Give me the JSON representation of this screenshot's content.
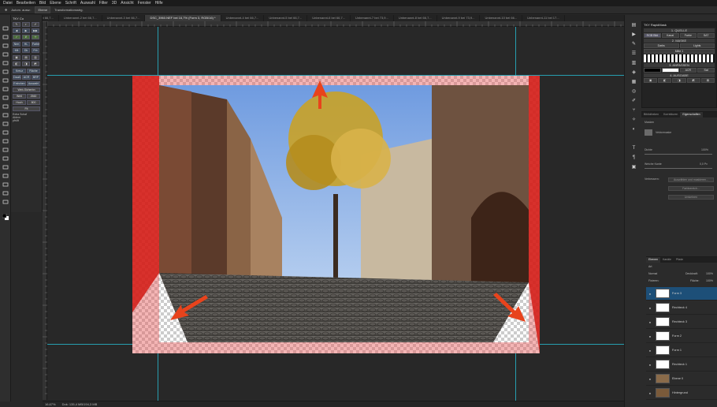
{
  "menu": [
    "Datei",
    "Bearbeiten",
    "Bild",
    "Ebene",
    "Schrift",
    "Auswahl",
    "Filter",
    "3D",
    "Ansicht",
    "Fenster",
    "Hilfe"
  ],
  "options": {
    "auto_select_label": "Autom. ausw.:",
    "layer_target": "Ebene",
    "transform_label": "Transformationsstrg."
  },
  "tabs": [
    {
      "label": "Unbenannt-1 bei 66,7...",
      "active": false
    },
    {
      "label": "Unbenannt-2 bei 66,7...",
      "active": false
    },
    {
      "label": "Unbenannt-3 bei 66,7...",
      "active": false
    },
    {
      "label": "DSC_3960.NEF bei 16,7% (Form 3, RGB/16) *",
      "active": true
    },
    {
      "label": "Unbenannt-4 bei 66,7...",
      "active": false
    },
    {
      "label": "Unbenannt-5 bei 66,7...",
      "active": false
    },
    {
      "label": "Unbenannt-6 bei 66,7...",
      "active": false
    },
    {
      "label": "Unbenannt-7 bei 73,9...",
      "active": false
    },
    {
      "label": "Unbenannt-8 bei 66,7...",
      "active": false
    },
    {
      "label": "Unbenannt-9 bei 73,9...",
      "active": false
    },
    {
      "label": "Unbenannt-10 bei 66...",
      "active": false
    },
    {
      "label": "Unbenannt-11 bei 17...",
      "active": false
    }
  ],
  "plugin": {
    "title": "TKY Co",
    "grid_a": [
      "Nrm",
      "HL",
      "Farbe",
      "Mit",
      "Dk",
      "Frb"
    ],
    "row_b": [
      "Kreuz",
      "Fläche"
    ],
    "row_c": [
      "Dauß",
      "ACR",
      "BRP"
    ],
    "row_d": [
      "Entrohen",
      "Auswahl"
    ],
    "row_e": [
      "Web-Sicherbn"
    ],
    "width_label": "Weit",
    "width_value": "2560",
    "height_label": "Hoch",
    "height_value": "800",
    "fit_label": "Fit",
    "checks": [
      "Extra Schaf",
      "Ablem",
      "pfrüft"
    ]
  },
  "tky": {
    "title": "TKY RapidMask",
    "section1": "1. QUELLE",
    "row1": [
      "RGB Bild",
      "Kanal",
      "Farbe",
      "SAT"
    ],
    "section2": "2. MASKE",
    "row2": [
      "Darks",
      "Lights"
    ],
    "row3": [
      "Mitte 1"
    ],
    "section3": "3. ANPASSEN",
    "section4": "4. AUSGABE",
    "row4": [
      "ACR",
      "Sat"
    ]
  },
  "props": {
    "tabs": [
      "Bibliotheken",
      "Korrekturen",
      "Eigenschaften"
    ],
    "active_tab": "Eigenschaften",
    "mask_label": "Masken",
    "vector_label": "Vektormaske",
    "density_label": "Dichte",
    "density_value": "100%",
    "feather_label": "Weiche Kante",
    "feather_value": "0,0 Px",
    "refine_label": "Verbessern:",
    "btn_select_mask": "Auswählen und maskieren...",
    "btn_color_range": "Farbbereich...",
    "btn_invert": "Umkehren"
  },
  "layers": {
    "tabs": [
      "Ebenen",
      "Kanäle",
      "Pfade"
    ],
    "active_tab": "Ebenen",
    "kind": "Art",
    "blend": "Normal",
    "opacity_label": "Deckkraft:",
    "opacity_value": "100%",
    "lock_label": "Fixieren:",
    "fill_label": "Fläche:",
    "fill_value": "100%",
    "items": [
      {
        "name": "Form 3",
        "active": true,
        "thumb": "#ffffff"
      },
      {
        "name": "Rechteck 4",
        "active": false,
        "thumb": "#ffffff"
      },
      {
        "name": "Rechteck 3",
        "active": false,
        "thumb": "#ffffff"
      },
      {
        "name": "Form 2",
        "active": false,
        "thumb": "#ffffff"
      },
      {
        "name": "Form 1",
        "active": false,
        "thumb": "#ffffff"
      },
      {
        "name": "Rechteck 1",
        "active": false,
        "thumb": "#ffffff"
      },
      {
        "name": "Ebene 0",
        "active": false,
        "thumb": "#8a6b4a"
      },
      {
        "name": "Hintergrund",
        "active": false,
        "thumb": "#7a5a3a"
      }
    ]
  },
  "status": {
    "zoom": "16,67%",
    "doc": "Dok: 135,4 MB/194,3 MB"
  },
  "colors": {
    "accent": "#27b3c8",
    "arrow": "#e8431c",
    "mask_red": "#d21a14",
    "layer_selected": "#1d4f78"
  }
}
